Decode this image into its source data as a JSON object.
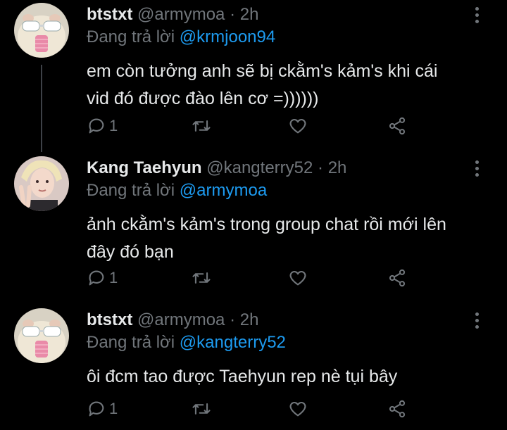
{
  "tweets": [
    {
      "display_name": "btstxt",
      "handle": "@armymoa",
      "separator": "·",
      "time": "2h",
      "reply_prefix": "Đang trả lời",
      "reply_to": "@krmjoon94",
      "text_line1": "em còn tưởng anh sẽ bị ckằm's kảm's khi cái",
      "text_line2": "vid đó được đào lên cơ =))))))",
      "reply_count": "1",
      "avatar_icon": "hamster-avatar"
    },
    {
      "display_name": "Kang Taehyun",
      "handle": "@kangterry52",
      "separator": "·",
      "time": "2h",
      "reply_prefix": "Đang trả lời",
      "reply_to": "@armymoa",
      "text_line1": "ảnh ckằm's kảm's trong group chat rồi mới lên",
      "text_line2": "đây đó bạn",
      "reply_count": "1",
      "avatar_icon": "person-peace-sign-avatar"
    },
    {
      "display_name": "btstxt",
      "handle": "@armymoa",
      "separator": "·",
      "time": "2h",
      "reply_prefix": "Đang trả lời",
      "reply_to": "@kangterry52",
      "text_line1": "ôi đcm tao được Taehyun rep nè tụi bây",
      "text_line2": "",
      "reply_count": "1",
      "avatar_icon": "hamster-avatar"
    }
  ],
  "icons": {
    "reply": "reply-icon",
    "retweet": "retweet-icon",
    "like": "heart-icon",
    "share": "share-icon",
    "more": "more-vertical-icon"
  },
  "colors": {
    "background": "#000000",
    "text": "#e7e9ea",
    "muted": "#71767b",
    "mention": "#1d9bf0",
    "thread_line": "#3d4147"
  }
}
